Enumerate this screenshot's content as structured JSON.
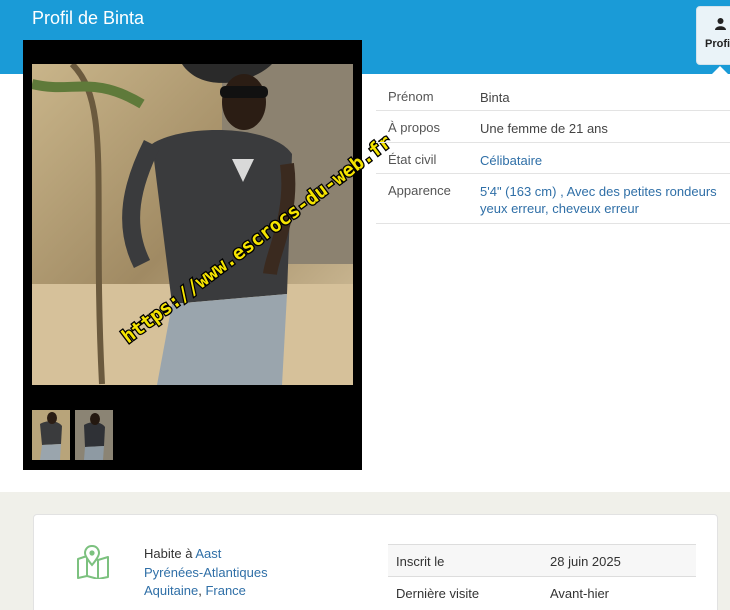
{
  "page": {
    "title": "Profil de Binta"
  },
  "tabs": {
    "profile_label": "Profil"
  },
  "watermark": "https://www.escrocs-du-web.fr",
  "profile_info": [
    {
      "label": "Prénom",
      "value": "Binta"
    },
    {
      "label": "À propos",
      "value": "Une femme de 21 ans"
    },
    {
      "label": "État civil",
      "value": "Célibataire"
    },
    {
      "label": "Apparence",
      "value_line1": "5'4\" (163 cm) , Avec des petites rondeurs",
      "value_line2": "yeux erreur, cheveux erreur"
    }
  ],
  "location": {
    "prefix": "Habite à ",
    "city": "Aast",
    "department": "Pyrénées-Atlantiques",
    "region": "Aquitaine",
    "separator": ", ",
    "country": "France"
  },
  "stats": [
    {
      "label": "Inscrit le",
      "value": "28 juin 2025"
    },
    {
      "label": "Dernière visite",
      "value": "Avant-hier"
    }
  ],
  "colors": {
    "header": "#1a9bd7",
    "link": "#2f6fa7",
    "map_icon": "#7cc17f"
  },
  "icons": {
    "profile_tab": "user-icon",
    "location": "map-marker-icon"
  }
}
